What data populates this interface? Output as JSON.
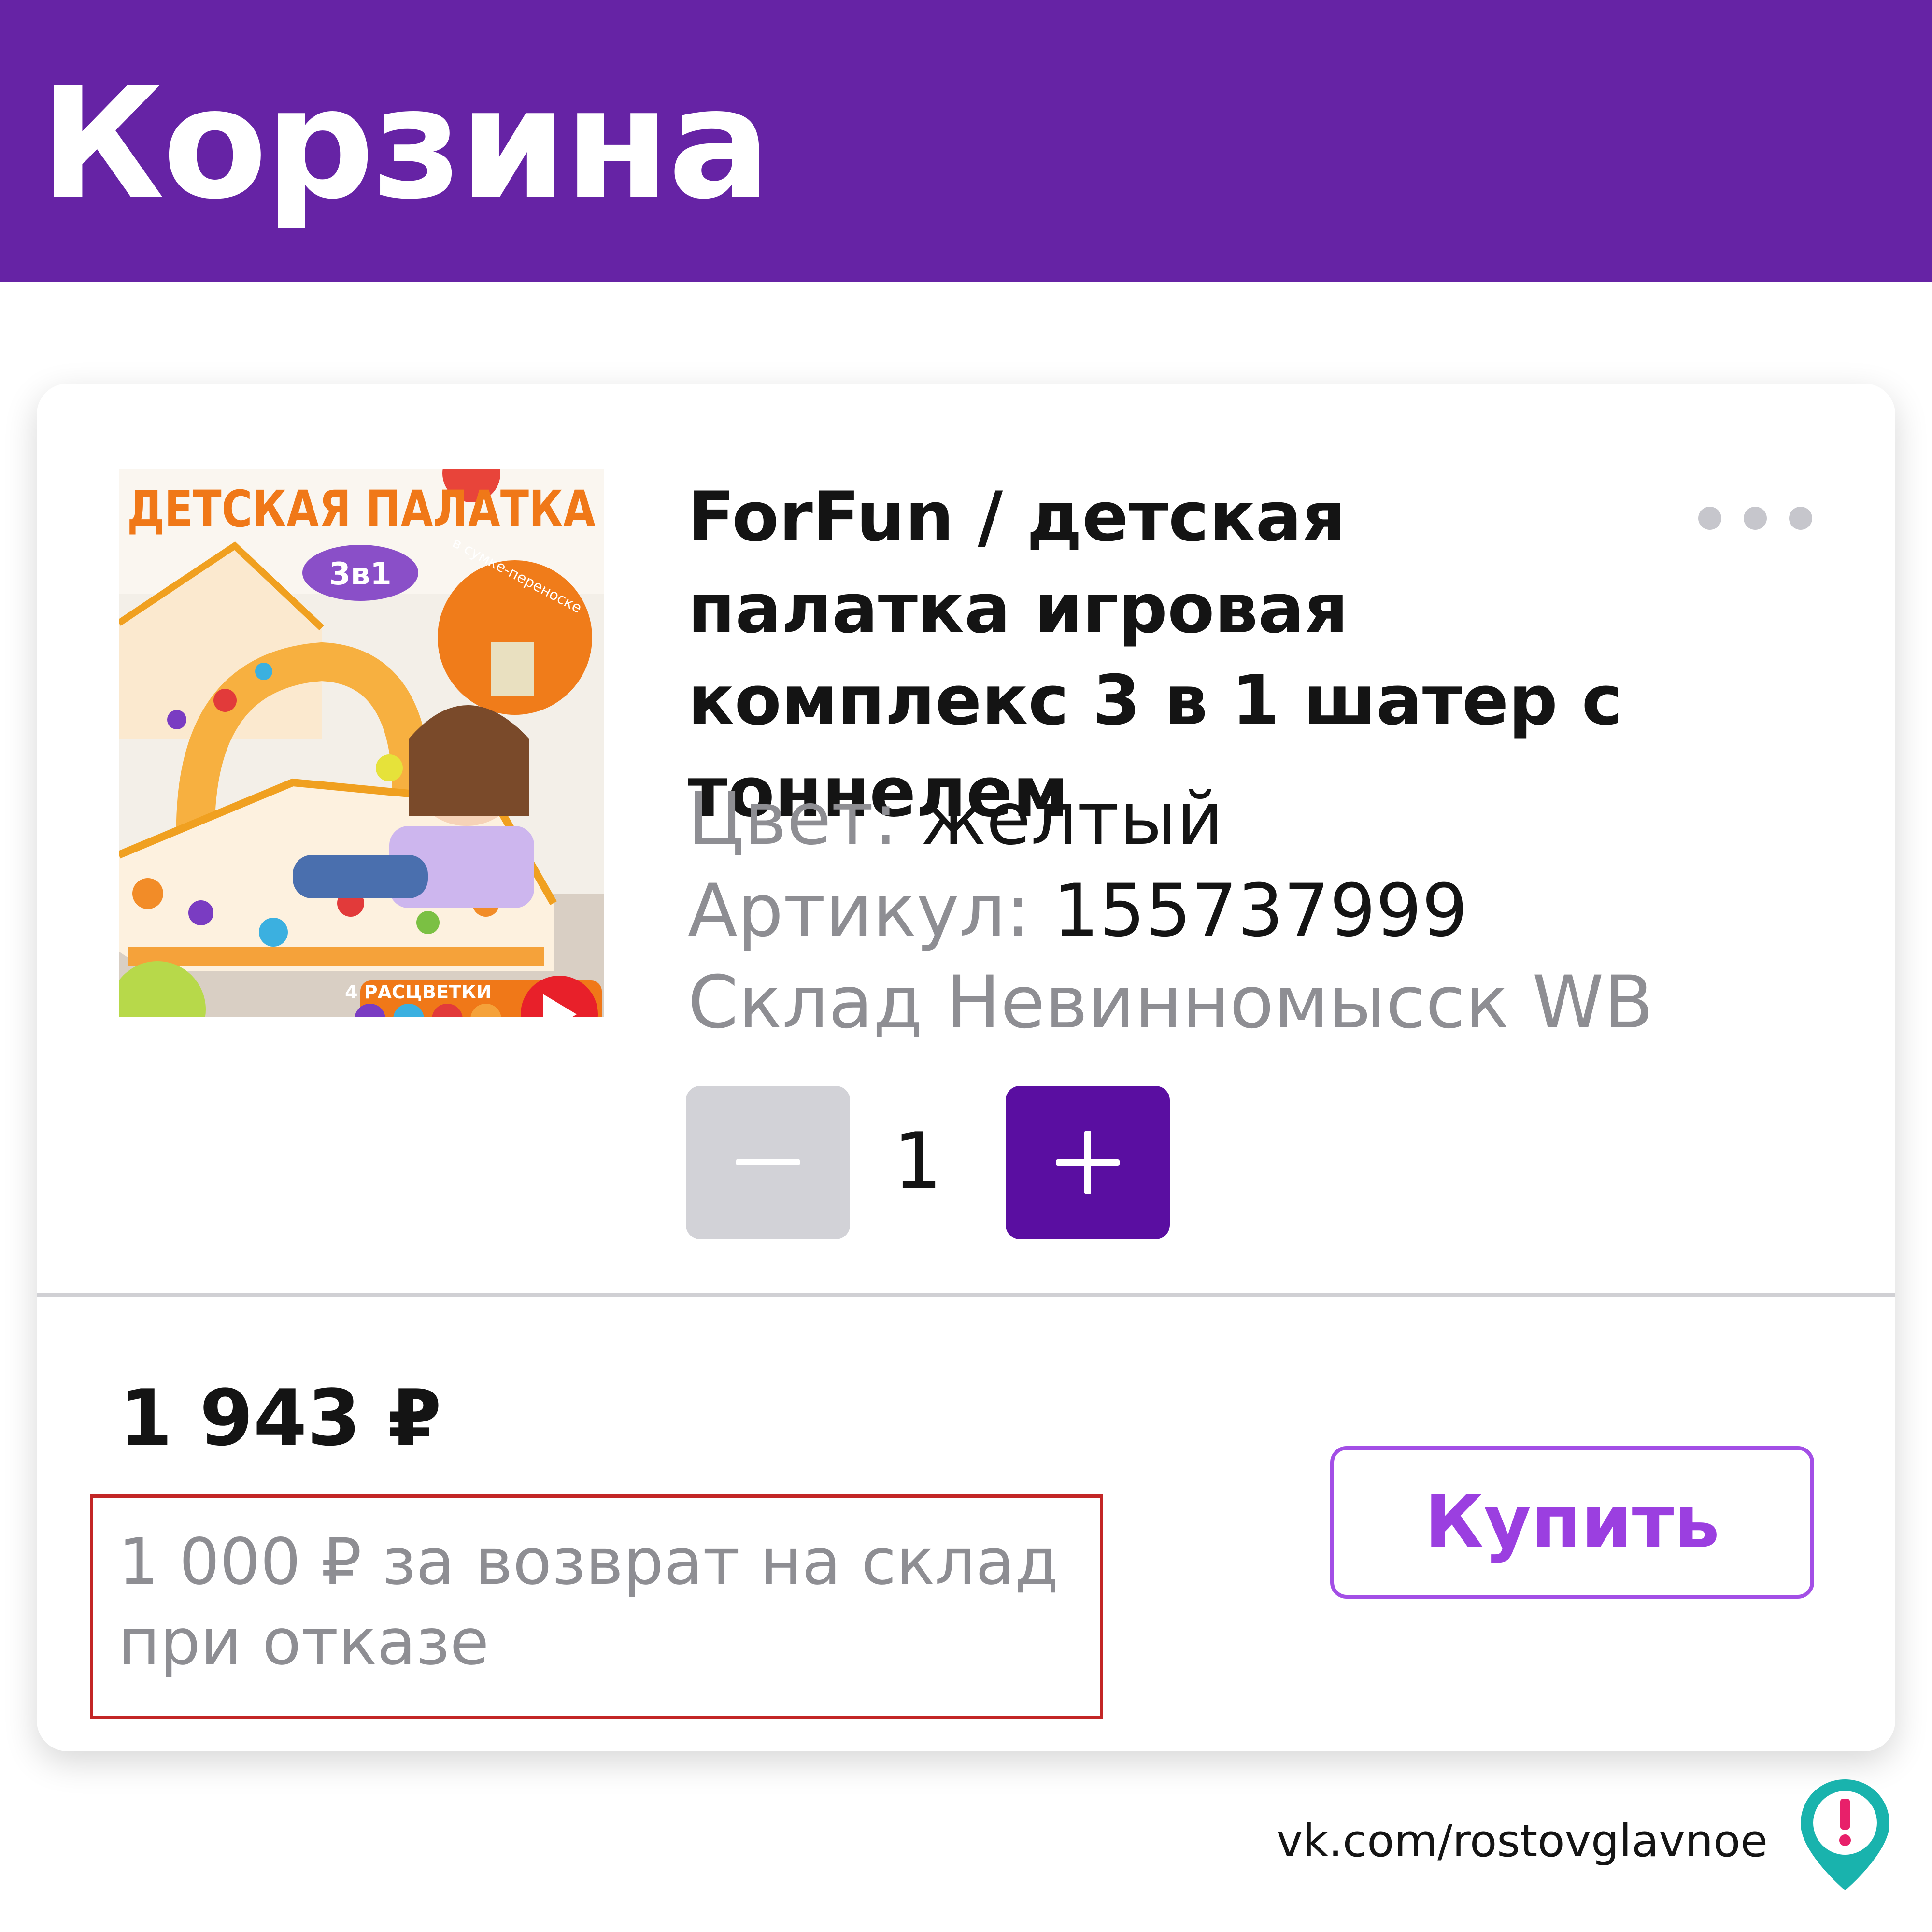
{
  "header": {
    "title": "Корзина"
  },
  "product": {
    "image": {
      "text_main": "ДЕТСКАЯ ПАЛАТКА",
      "text_badge": "3в1",
      "text_arc": "в сумке-переноске",
      "text_colors": "4 РАСЦВЕТКИ"
    },
    "title": "ForFun / детская палатка игровая комплекс 3 в 1 шатер с тоннелем",
    "color_label": "Цвет:",
    "color_value": "желтый",
    "sku_label": "Артикул:",
    "sku_value": "155737999",
    "warehouse": "Склад Невинномысск WB",
    "quantity": "1"
  },
  "price": "1 943 ₽",
  "return_note": "1 000 ₽ за возврат на склад при отказе",
  "buy_label": "Купить",
  "watermark": "vk.com/rostovglavnoe",
  "colors": {
    "header_bg": "#6623a5",
    "plus_button": "#5a0ea1",
    "buy_button": "#9b3fe0",
    "highlight_box": "#c32626",
    "muted_text": "#8e8e93"
  },
  "icons": [
    "more-icon",
    "minus-icon",
    "plus-icon",
    "play-icon",
    "location-pin-icon"
  ]
}
